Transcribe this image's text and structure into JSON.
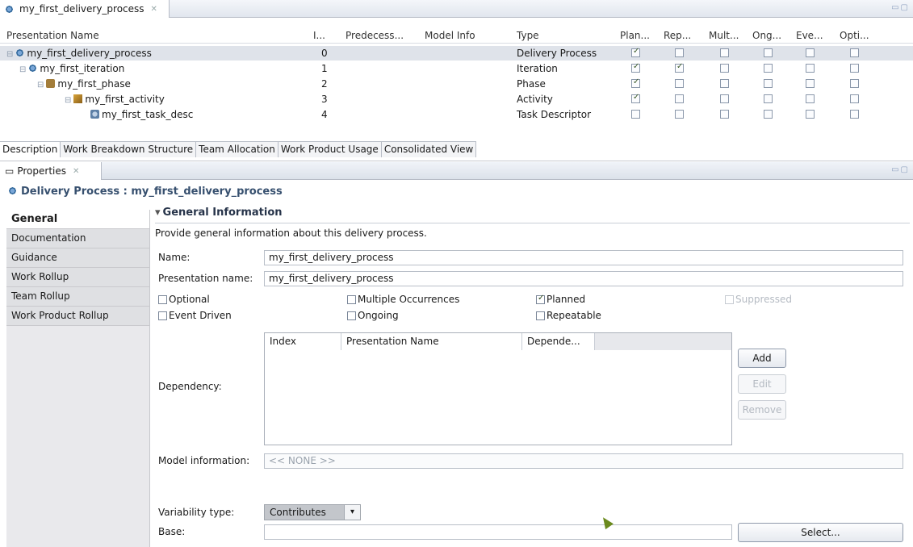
{
  "editor": {
    "tab_title": "my_first_delivery_process",
    "columns": [
      "Presentation Name",
      "I...",
      "Predecess...",
      "Model Info",
      "Type",
      "Plan...",
      "Rep...",
      "Mult...",
      "Ong...",
      "Eve...",
      "Opti..."
    ],
    "rows": [
      {
        "name": "my_first_delivery_process",
        "index": "0",
        "type": "Delivery Process",
        "icon": "delivery-process-icon",
        "checks": [
          true,
          false,
          false,
          false,
          false,
          false
        ]
      },
      {
        "name": "my_first_iteration",
        "index": "1",
        "type": "Iteration",
        "icon": "iteration-icon",
        "checks": [
          true,
          true,
          false,
          false,
          false,
          false
        ]
      },
      {
        "name": "my_first_phase",
        "index": "2",
        "type": "Phase",
        "icon": "phase-icon",
        "checks": [
          true,
          false,
          false,
          false,
          false,
          false
        ]
      },
      {
        "name": "my_first_activity",
        "index": "3",
        "type": "Activity",
        "icon": "activity-icon",
        "checks": [
          true,
          false,
          false,
          false,
          false,
          false
        ]
      },
      {
        "name": "my_first_task_desc",
        "index": "4",
        "type": "Task Descriptor",
        "icon": "task-descriptor-icon",
        "checks": [
          false,
          false,
          false,
          false,
          false,
          false
        ]
      }
    ],
    "bottom_tabs": [
      "Description",
      "Work Breakdown Structure",
      "Team Allocation",
      "Work Product Usage",
      "Consolidated View"
    ]
  },
  "properties": {
    "tab_title": "Properties",
    "header": "Delivery Process : my_first_delivery_process",
    "sidebar": [
      "General",
      "Documentation",
      "Guidance",
      "Work Rollup",
      "Team Rollup",
      "Work Product Rollup"
    ],
    "section_title": "General Information",
    "description": "Provide general information about this delivery process.",
    "name_label": "Name:",
    "name_value": "my_first_delivery_process",
    "presentation_label": "Presentation name:",
    "presentation_value": "my_first_delivery_process",
    "checkboxes": {
      "optional": "Optional",
      "event_driven": "Event Driven",
      "multiple": "Multiple Occurrences",
      "ongoing": "Ongoing",
      "planned": "Planned",
      "repeatable": "Repeatable",
      "suppressed": "Suppressed"
    },
    "dependency_label": "Dependency:",
    "dependency_columns": [
      "Index",
      "Presentation Name",
      "Depende..."
    ],
    "buttons": {
      "add": "Add",
      "edit": "Edit",
      "remove": "Remove",
      "select": "Select..."
    },
    "model_info_label": "Model information:",
    "model_info_value": "<< NONE >>",
    "variability_label": "Variability type:",
    "variability_value": "Contributes",
    "base_label": "Base:"
  }
}
